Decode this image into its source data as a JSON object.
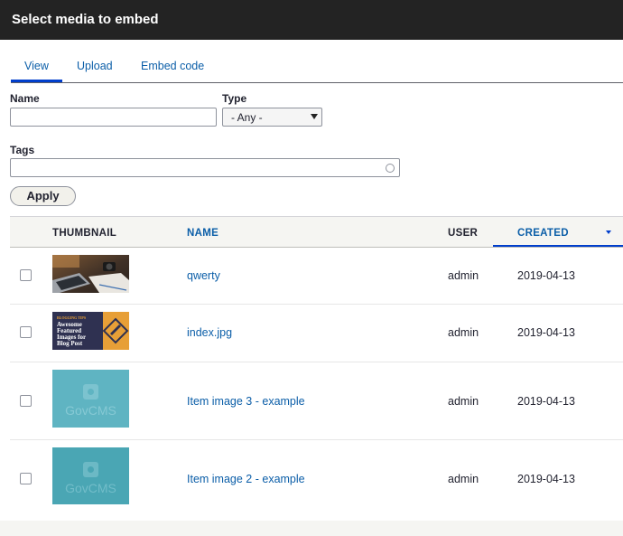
{
  "dialog": {
    "title": "Select media to embed"
  },
  "tabs": [
    {
      "label": "View",
      "active": true
    },
    {
      "label": "Upload",
      "active": false
    },
    {
      "label": "Embed code",
      "active": false
    }
  ],
  "filters": {
    "name_label": "Name",
    "name_value": "",
    "type_label": "Type",
    "type_selected": "- Any -",
    "tags_label": "Tags",
    "tags_value": "",
    "apply_label": "Apply"
  },
  "table": {
    "columns": {
      "thumbnail": "THUMBNAIL",
      "name": "NAME",
      "user": "USER",
      "created": "CREATED"
    },
    "sort": {
      "column": "created",
      "direction": "descending"
    },
    "rows": [
      {
        "name": "qwerty",
        "user": "admin",
        "created": "2019-04-13",
        "thumbnail": "laptop-desk-photo"
      },
      {
        "name": "index.jpg",
        "user": "admin",
        "created": "2019-04-13",
        "thumbnail": "awesome-featured-images-banner",
        "thumbnail_text": [
          "BLOGGING TIPS",
          "Awesome",
          "Featured",
          "Images for",
          "Blog Post"
        ]
      },
      {
        "name": "Item image 3 - example",
        "user": "admin",
        "created": "2019-04-13",
        "thumbnail": "govcms-placeholder",
        "thumbnail_text": "GovCMS"
      },
      {
        "name": "Item image 2 - example",
        "user": "admin",
        "created": "2019-04-13",
        "thumbnail": "govcms-placeholder",
        "thumbnail_text": "GovCMS"
      }
    ]
  },
  "colors": {
    "titlebar_bg": "#232323",
    "link": "#0b5ea8",
    "active_underline": "#003ecc",
    "header_bg": "#f5f5f2"
  }
}
